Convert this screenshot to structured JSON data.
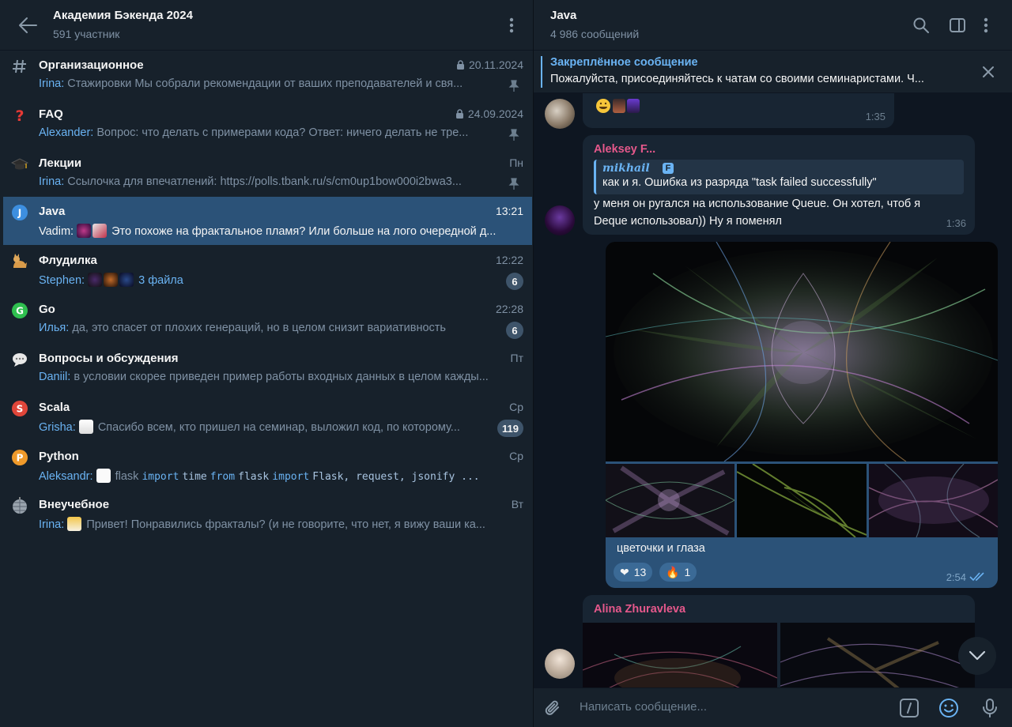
{
  "group": {
    "title": "Академия Бэкенда 2024",
    "subtitle": "591 участник"
  },
  "topics": [
    {
      "name": "Организационное",
      "date": "20.11.2024",
      "locked": true,
      "pinned": true,
      "sender": "Irina:",
      "preview": " Стажировки   Мы собрали рекомендации от ваших преподавателей и свя...",
      "icon": "hash-icon"
    },
    {
      "name": "FAQ",
      "date": "24.09.2024",
      "locked": true,
      "pinned": true,
      "sender": "Alexander:",
      "preview": " Вопрос: что делать с примерами кода?  Ответ: ничего делать не тре...",
      "icon": "question-icon"
    },
    {
      "name": "Лекции",
      "date": "Пн",
      "pinned": true,
      "sender": "Irina:",
      "preview": " Ссылочка для впечатлений:  https://polls.tbank.ru/s/cm0up1bow000i2bwa3...",
      "icon": "graduation-cap-icon"
    },
    {
      "name": "Java",
      "date": "13:21",
      "active": true,
      "sender": "Vadim:",
      "preview": " Это похоже на фрактальное пламя? Или больше на лого очередной д...",
      "icon": "java-icon"
    },
    {
      "name": "Флудилка",
      "date": "12:22",
      "badge": "6",
      "sender": "Stephen:",
      "preview": "3 файла",
      "icon": "cat-icon"
    },
    {
      "name": "Go",
      "date": "22:28",
      "badge": "6",
      "sender": "Илья:",
      "preview": " да, это спасет от плохих генераций, но в целом снизит вариативность",
      "icon": "go-icon"
    },
    {
      "name": "Вопросы и обсуждения",
      "date": "Пт",
      "sender": "Daniil:",
      "preview": " в условии скорее приведен пример работы входных данных в целом кажды...",
      "icon": "speech-bubble-icon"
    },
    {
      "name": "Scala",
      "date": "Ср",
      "badge": "119",
      "sender": "Grisha:",
      "preview": "Спасибо всем, кто пришел на семинар, выложил код, по которому...",
      "icon": "scala-icon"
    },
    {
      "name": "Python",
      "date": "Ср",
      "sender": "Aleksandr:",
      "preview_code": {
        "w1": "flask",
        "k1": "import",
        "w2": "time",
        "k2": "from",
        "w3": "flask",
        "k3": "import",
        "w4": "Flask, request, jsonify ..."
      },
      "icon": "python-icon"
    },
    {
      "name": "Внеучебное",
      "date": "Вт",
      "sender": "Irina:",
      "preview": "Привет!   Понравились фракталы?  (и не говорите, что нет, я вижу ваши ка...",
      "icon": "disco-ball-icon"
    }
  ],
  "chat": {
    "title": "Java",
    "subtitle": "4 986 сообщений"
  },
  "pinned": {
    "title": "Закреплённое сообщение",
    "text": "Пожалуйста, присоединяйтесь к чатам со своими семинаристами.  Ч..."
  },
  "messages": {
    "m1": {
      "time": "1:35"
    },
    "m2": {
      "sender": "Aleksey F...",
      "reply_author": "mikhail",
      "reply_badge": "F",
      "reply_text": "как и я. Ошибка из разряда \"task failed successfully\"",
      "text_line1": "у меня он ругался на использование Queue. Он хотел, чтоб я",
      "text_line2": "Deque использовал)) Ну я поменял",
      "time": "1:36"
    },
    "m3": {
      "caption": "цветочки и глаза",
      "reactions": [
        {
          "emoji": "❤️‍🔥",
          "count": "13"
        },
        {
          "emoji": "🔥",
          "count": "1"
        }
      ],
      "time": "2:54"
    },
    "m4": {
      "sender": "Alina Zhuravleva"
    }
  },
  "composer": {
    "placeholder": "Написать сообщение..."
  },
  "colors": {
    "accent": "#6ab3f3",
    "active_topic": "#2b5278",
    "sender_pink": "#e5588b",
    "bg": "#0e1621",
    "panel": "#17212b"
  }
}
